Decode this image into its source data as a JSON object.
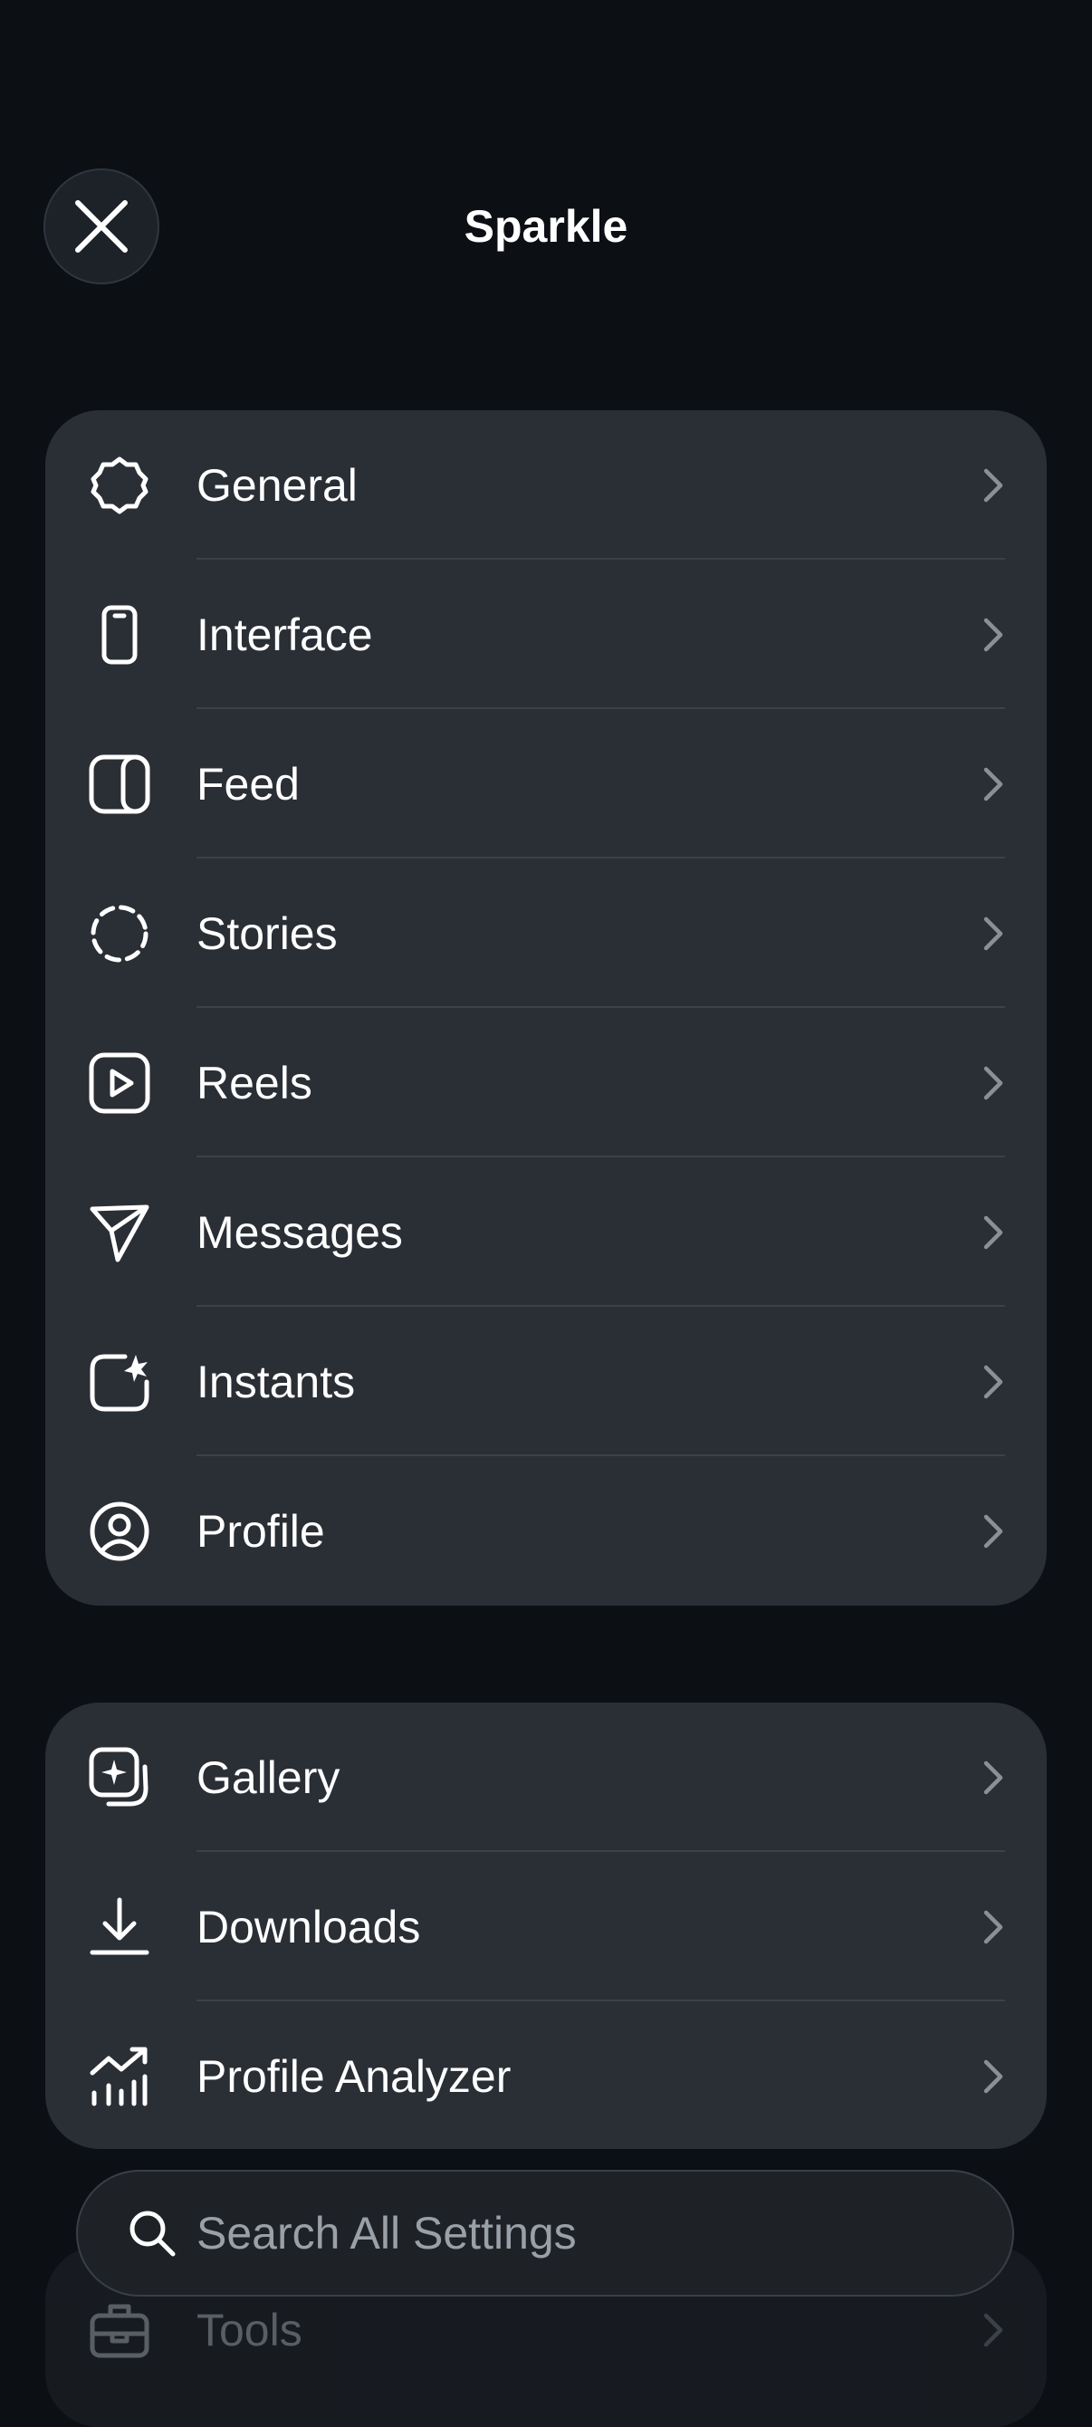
{
  "header": {
    "title": "Sparkle",
    "close_icon": "close-icon"
  },
  "groups": [
    {
      "items": [
        {
          "label": "General",
          "icon": "gear-icon"
        },
        {
          "label": "Interface",
          "icon": "phone-icon"
        },
        {
          "label": "Feed",
          "icon": "feed-icon"
        },
        {
          "label": "Stories",
          "icon": "dashed-circle-icon"
        },
        {
          "label": "Reels",
          "icon": "play-square-icon"
        },
        {
          "label": "Messages",
          "icon": "send-icon"
        },
        {
          "label": "Instants",
          "icon": "instants-icon"
        },
        {
          "label": "Profile",
          "icon": "user-circle-icon"
        }
      ]
    },
    {
      "items": [
        {
          "label": "Gallery",
          "icon": "gallery-icon"
        },
        {
          "label": "Downloads",
          "icon": "download-icon"
        },
        {
          "label": "Profile Analyzer",
          "icon": "chart-trend-icon"
        }
      ]
    },
    {
      "items": [
        {
          "label": "Tools",
          "icon": "toolbox-icon"
        }
      ]
    }
  ],
  "search": {
    "placeholder": "Search All Settings",
    "icon": "search-icon"
  },
  "colors": {
    "background": "#0c0f14",
    "card": "#2a2e35",
    "separator": "#3c414a",
    "chevron": "#8a9099",
    "text": "#ffffff",
    "placeholder": "#9aa0a8"
  }
}
